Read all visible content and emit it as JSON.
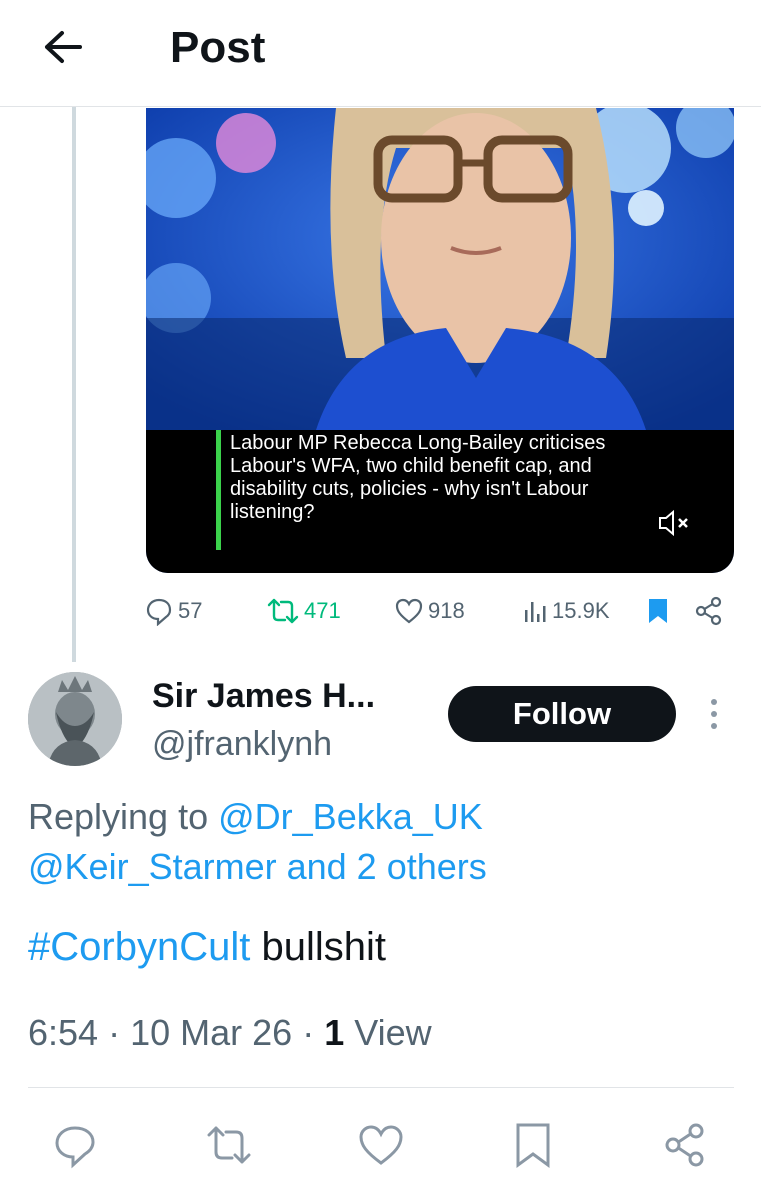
{
  "header": {
    "title": "Post"
  },
  "media": {
    "caption": "Labour MP Rebecca Long-Bailey criticises Labour's WFA, two child benefit cap, and disability cuts, policies - why isn't Labour listening?"
  },
  "stats": {
    "replies": "57",
    "reposts": "471",
    "likes": "918",
    "views": "15.9K"
  },
  "reply": {
    "display_name": "Sir James H...",
    "handle": "@jfranklynh",
    "follow_label": "Follow",
    "replying_prefix": "Replying to",
    "replying_mention": "@Dr_Bekka_UK",
    "replying_rest": "@Keir_Starmer and 2 others",
    "hashtag": "#CorbynCult",
    "text": "bullshit",
    "time": "6:54",
    "date": "10 Mar 26",
    "views_count": "1",
    "views_label": "View"
  },
  "colors": {
    "accent": "#1d9bf0",
    "repost_green": "#00ba7c",
    "muted": "#536471",
    "caption_bar": "#3bd24b"
  },
  "icons": [
    "back-arrow-icon",
    "reply-icon",
    "repost-icon",
    "like-icon",
    "views-icon",
    "bookmark-icon",
    "share-icon",
    "mute-icon",
    "more-icon"
  ]
}
